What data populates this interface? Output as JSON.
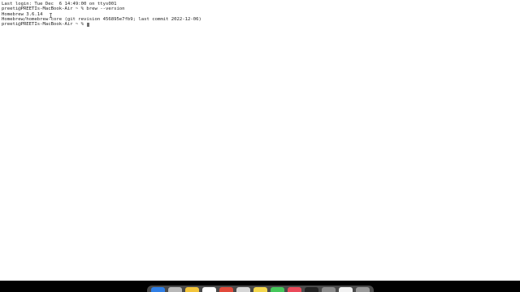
{
  "terminal": {
    "lines": {
      "last_login": "Last login: Tue Dec  6 14:49:00 on ttys001",
      "command_prompt": "preeti@PREETIs-MacBook-Air ~ % brew --version",
      "brew_version": "Homebrew 3.6.14",
      "core_info": "Homebrew/homebrew-core (git revision 456895e7fb9; last commit 2022-12-06)",
      "current_prompt": "preeti@PREETIs-MacBook-Air ~ % "
    }
  },
  "dock": {
    "icons": [
      {
        "name": "finder-icon",
        "color": "#2f7fe6"
      },
      {
        "name": "launchpad-icon",
        "color": "#b9b9b9"
      },
      {
        "name": "notes-icon",
        "color": "#f3c53a"
      },
      {
        "name": "calendar-icon",
        "color": "#ffffff"
      },
      {
        "name": "photos-icon",
        "color": "#e24a3b"
      },
      {
        "name": "preview-icon",
        "color": "#d7d7d7"
      },
      {
        "name": "stickies-icon",
        "color": "#f4d84e"
      },
      {
        "name": "messages-icon",
        "color": "#45c85b"
      },
      {
        "name": "music-icon",
        "color": "#ea4a5a"
      },
      {
        "name": "terminal-icon",
        "color": "#222222"
      },
      {
        "name": "system-settings-icon",
        "color": "#8c8c8c"
      },
      {
        "name": "app-store-icon",
        "color": "#f2f2f2"
      },
      {
        "name": "trash-icon",
        "color": "#9a9a9a"
      }
    ]
  }
}
